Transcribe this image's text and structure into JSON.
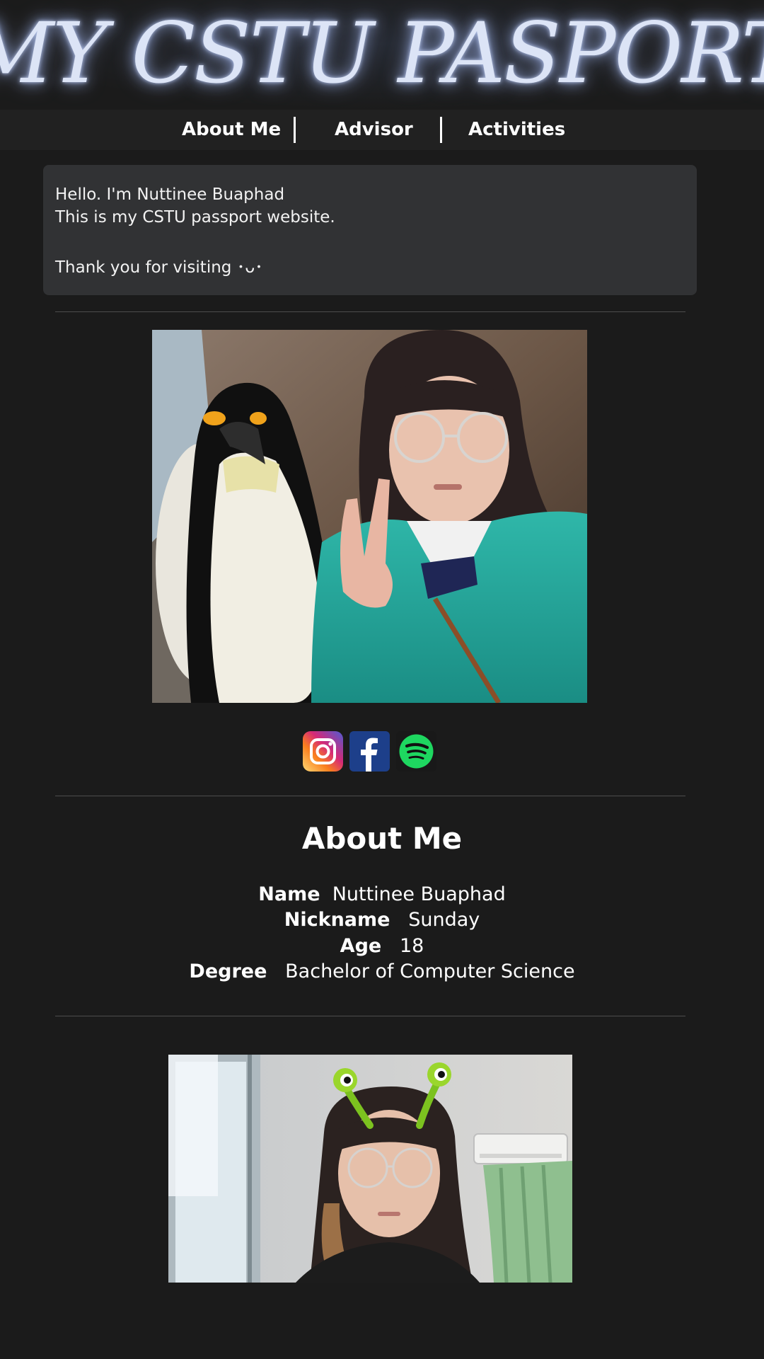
{
  "header": {
    "title": "MY CSTU PASPORT"
  },
  "nav": {
    "items": [
      {
        "label": "About Me"
      },
      {
        "label": "Advisor"
      },
      {
        "label": "Activities"
      }
    ]
  },
  "intro": {
    "line1": "Hello. I'm Nuttinee Buaphad",
    "line2": "This is my CSTU passport website.",
    "line3": "Thank you for visiting ･ᴗ･"
  },
  "photos": {
    "main": "selfie-with-penguin-photo",
    "second": "selfie-with-alien-headband-photo"
  },
  "social": [
    {
      "icon": "instagram-icon"
    },
    {
      "icon": "facebook-icon"
    },
    {
      "icon": "spotify-icon"
    }
  ],
  "about": {
    "title": "About Me",
    "rows": [
      {
        "key": "Name",
        "value": "Nuttinee Buaphad"
      },
      {
        "key": "Nickname",
        "value": "Sunday"
      },
      {
        "key": "Age",
        "value": "18"
      },
      {
        "key": "Degree",
        "value": "Bachelor of Computer Science"
      }
    ]
  },
  "colors": {
    "background": "#1b1b1b",
    "navbar": "#212121",
    "intro_box": "#313234",
    "instagram": "#d62976",
    "facebook": "#1d3f8a",
    "spotify": "#1ed760"
  }
}
